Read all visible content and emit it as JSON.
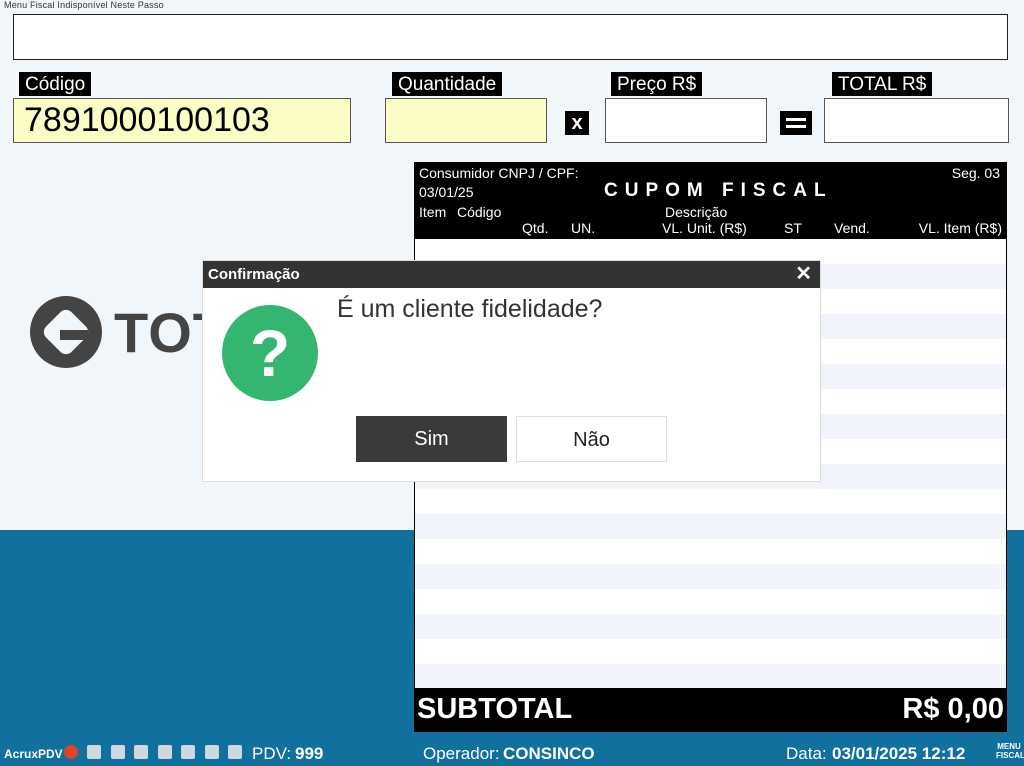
{
  "caption": "Menu Fiscal Indisponível Neste Passo",
  "entry": {
    "codigo_label": "Código",
    "codigo_value": "7891000100103",
    "quantidade_label": "Quantidade",
    "quantidade_value": "",
    "multiply_symbol": "x",
    "preco_label": "Preço R$",
    "preco_value": "",
    "total_label": "TOTAL R$",
    "total_value": ""
  },
  "brand": {
    "logo_text": "TOT"
  },
  "receipt": {
    "consumer_label": "Consumidor CNPJ / CPF:",
    "sequence": "Seg. 03",
    "date": "03/01/25",
    "title": "CUPOM FISCAL",
    "columns": {
      "item": "Item",
      "codigo": "Código",
      "descricao": "Descrição",
      "qtd": "Qtd.",
      "un": "UN.",
      "vl_unit": "VL. Unit. (R$)",
      "st": "ST",
      "vend": "Vend.",
      "vl_item": "VL. Item (R$)"
    },
    "subtotal_label": "SUBTOTAL",
    "subtotal_value": "R$ 0,00"
  },
  "dialog": {
    "title": "Confirmação",
    "close_glyph": "✕",
    "icon": "question-icon",
    "icon_glyph": "?",
    "message": "É um cliente fidelidade?",
    "yes_label": "Sim",
    "no_label": "Não"
  },
  "status_bar": {
    "app_name": "AcruxPDV",
    "pdv_label": "PDV:",
    "pdv_value": "999",
    "operador_label": "Operador:",
    "operador_value": "CONSINCO",
    "data_label": "Data:",
    "data_value": "03/01/2025 12:12",
    "menu_fiscal_line1": "MENU",
    "menu_fiscal_line2": "FISCAL"
  },
  "colors": {
    "background": "#f0f6f9",
    "band": "#11709d",
    "input_yellow": "#fbfdc4",
    "question_green": "#34b670",
    "dialog_title": "#333333",
    "primary_button": "#3a3a3a"
  }
}
